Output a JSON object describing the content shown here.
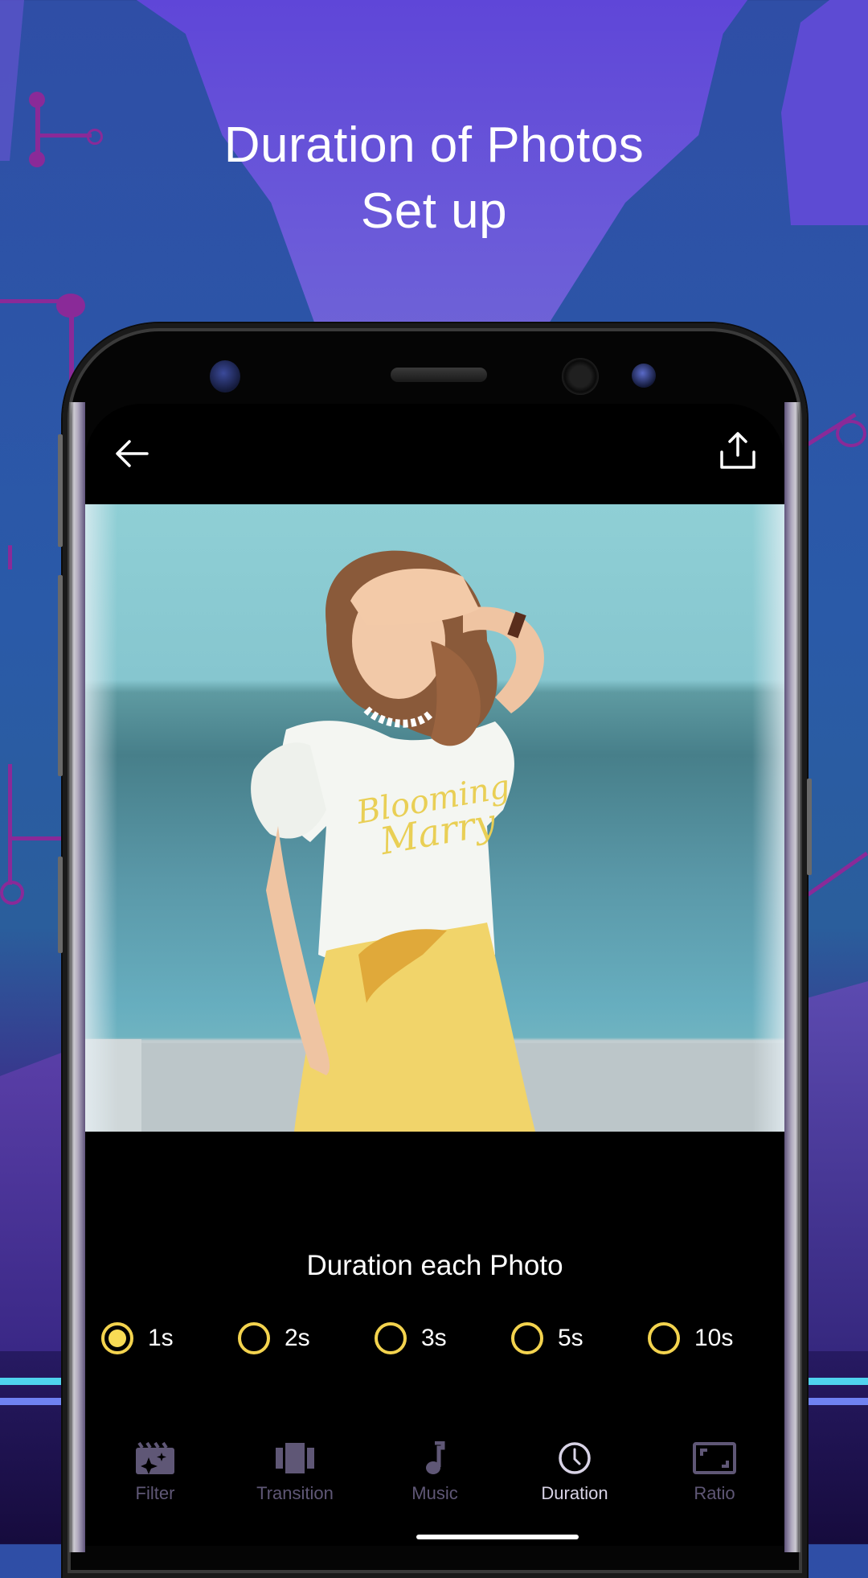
{
  "promo": {
    "headline_line1": "Duration of Photos",
    "headline_line2": "Set up"
  },
  "colors": {
    "accent_yellow": "#f3d34e",
    "tab_inactive": "#5f5776",
    "tab_active": "#d8d3e6",
    "background_purple": "#5f46d8",
    "background_blue": "#2a5aa8"
  },
  "app": {
    "topbar": {
      "back_icon": "arrow-left-icon",
      "share_icon": "share-upload-icon"
    },
    "photo": {
      "description": "Woman in white t-shirt and yellow skirt by the sea"
    },
    "duration": {
      "title": "Duration each Photo",
      "selected": "1s",
      "options": [
        {
          "label": "1s",
          "selected": true
        },
        {
          "label": "2s",
          "selected": false
        },
        {
          "label": "3s",
          "selected": false
        },
        {
          "label": "5s",
          "selected": false
        },
        {
          "label": "10s",
          "selected": false
        }
      ]
    },
    "tabs": [
      {
        "label": "Filter",
        "icon": "clapperboard-sparkle-icon",
        "active": false
      },
      {
        "label": "Transition",
        "icon": "transition-frames-icon",
        "active": false
      },
      {
        "label": "Music",
        "icon": "music-note-icon",
        "active": false
      },
      {
        "label": "Duration",
        "icon": "clock-icon",
        "active": true
      },
      {
        "label": "Ratio",
        "icon": "aspect-ratio-icon",
        "active": false
      }
    ]
  }
}
